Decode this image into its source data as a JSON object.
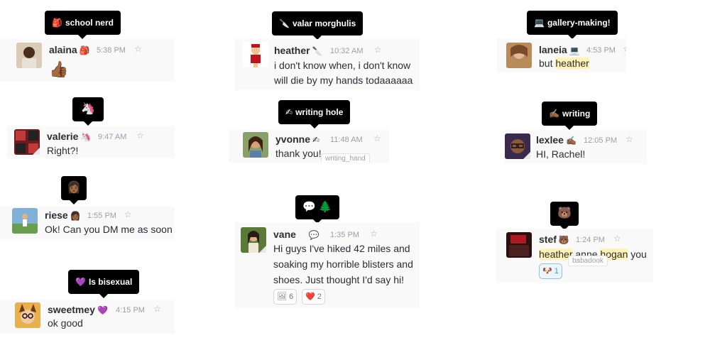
{
  "tooltips": {
    "school_nerd": {
      "icon": "🎒",
      "text": "school nerd"
    },
    "valar": {
      "icon": "🔪",
      "text": "valar morghulis"
    },
    "gallery": {
      "icon": "💻",
      "text": "gallery-making!"
    },
    "unicorn": {
      "icon": "🦄",
      "text": ""
    },
    "writing_hole": {
      "icon": "✍",
      "text": "writing hole"
    },
    "writing": {
      "icon": "✍🏾",
      "text": "writing"
    },
    "photo": {
      "icon": "👩🏾",
      "text": ""
    },
    "speech_tree": {
      "icon": "💬 🌲",
      "text": ""
    },
    "bear": {
      "icon": "🐻",
      "text": ""
    },
    "bisexual": {
      "icon": "💜",
      "text": "Is bisexual"
    }
  },
  "messages": {
    "alaina": {
      "name": "alaina",
      "status": "🎒",
      "time": "5:38 PM",
      "text": "👍🏾"
    },
    "heather": {
      "name": "heather",
      "status": "🔪",
      "time": "10:32 AM",
      "line1": "i don't know when, i don't know",
      "line2": "will die by my hands todaaaaaa"
    },
    "laneia": {
      "name": "laneia",
      "status": "💻",
      "time": "4:53 PM",
      "pre": "but ",
      "hl": "heather"
    },
    "valerie": {
      "name": "valerie",
      "status": "🦄",
      "time": "9:47 AM",
      "text": "Right?!"
    },
    "yvonne": {
      "name": "yvonne",
      "status": "✍",
      "time": "11:48 AM",
      "text": "thank you!",
      "hover": "writing_hand"
    },
    "lexlee": {
      "name": "lexlee",
      "status": "✍🏾",
      "time": "12:05 PM",
      "text": "HI, Rachel!"
    },
    "riese": {
      "name": "riese",
      "status": "👩🏾",
      "time": "1:55 PM",
      "text": "Ok! Can you DM me as soon"
    },
    "vane": {
      "name": "vane",
      "status": "💬",
      "time": "1:35 PM",
      "line1": "Hi guys I've hiked 42 miles and",
      "line2": "soaking my horrible blisters and",
      "line3": "shoes. Just thought I'd say hi!",
      "reactions": [
        {
          "emoji": "🖼",
          "count": "6"
        },
        {
          "emoji": "❤️",
          "count": "2"
        }
      ]
    },
    "stef": {
      "name": "stef",
      "status": "🐻",
      "time": "1:24 PM",
      "hl1": "heather",
      "mid": " anne ",
      "hl2": "hogan",
      "post": " you",
      "hover": "babadook",
      "reaction": {
        "emoji": "🐶",
        "count": "1"
      }
    },
    "sweetmey": {
      "name": "sweetmey",
      "status": "💜",
      "time": "4:15 PM",
      "text": "ok good"
    }
  },
  "colors": {
    "accent": "#2d9ee0",
    "highlight": "#fff3b5",
    "tooltip_bg": "#000000",
    "card_bg": "#f9f9f9"
  }
}
